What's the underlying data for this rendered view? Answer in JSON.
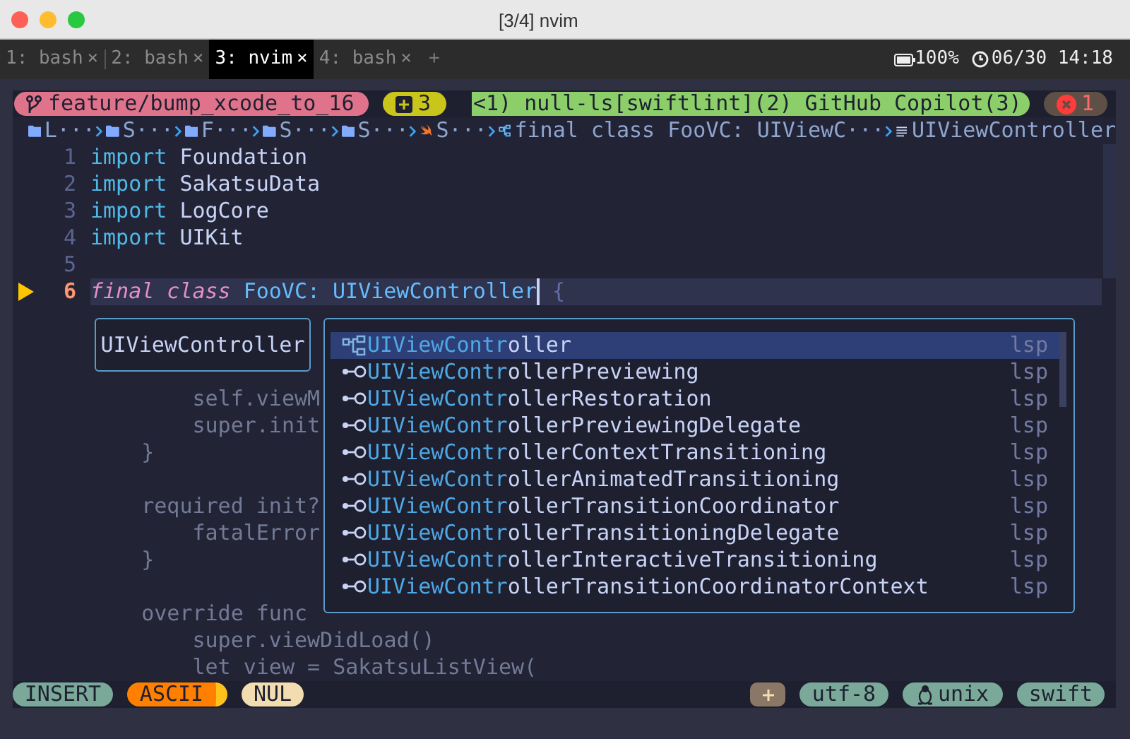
{
  "window": {
    "title": "[3/4] nvim"
  },
  "tabs": [
    {
      "label": "1: bash",
      "close": "×",
      "selected": false
    },
    {
      "label": "2: bash",
      "close": "×",
      "selected": false
    },
    {
      "label": "3: nvim",
      "close": "×",
      "selected": true
    },
    {
      "label": "4: bash",
      "close": "×",
      "selected": false
    }
  ],
  "new_tab": "+",
  "system_status": {
    "battery": "100%",
    "clock": "06/30 14:18"
  },
  "statusline": {
    "branch": "feature/bump_xcode_to_16",
    "added": "3",
    "lsp": "<1) null-ls[swiftlint](2) GitHub Copilot(3)",
    "errors": "1"
  },
  "breadcrumbs": [
    {
      "kind": "folder",
      "text": "L···"
    },
    {
      "kind": "folder",
      "text": "S···"
    },
    {
      "kind": "folder",
      "text": "F···"
    },
    {
      "kind": "folder",
      "text": "S···"
    },
    {
      "kind": "folder",
      "text": "S···"
    },
    {
      "kind": "swift",
      "text": "S···"
    },
    {
      "kind": "class",
      "text": "final class FooVC: UIViewC···"
    },
    {
      "kind": "field",
      "text": "UIViewController"
    }
  ],
  "lines": [
    {
      "number": "1",
      "current": false,
      "tokens": [
        {
          "kind": "keyword",
          "text": "import"
        },
        {
          "kind": "name",
          "text": "Foundation"
        }
      ]
    },
    {
      "number": "2",
      "current": false,
      "tokens": [
        {
          "kind": "keyword",
          "text": "import"
        },
        {
          "kind": "name",
          "text": "SakatsuData"
        }
      ]
    },
    {
      "number": "3",
      "current": false,
      "tokens": [
        {
          "kind": "keyword",
          "text": "import"
        },
        {
          "kind": "name",
          "text": "LogCore"
        }
      ]
    },
    {
      "number": "4",
      "current": false,
      "tokens": [
        {
          "kind": "keyword",
          "text": "import"
        },
        {
          "kind": "name",
          "text": "UIKit"
        }
      ]
    },
    {
      "number": "5",
      "current": false
    },
    {
      "number": "6",
      "current": true,
      "tokens": [
        {
          "kind": "storage",
          "text": "final class"
        },
        {
          "kind": "type",
          "text": "FooVC:"
        },
        {
          "kind": "type",
          "text": "UIViewController",
          "cursor_after": true
        },
        {
          "kind": "punct",
          "text": "{"
        }
      ]
    }
  ],
  "dimmed_lines": [
    {
      "kind": "code",
      "text": "        self.viewM"
    },
    {
      "kind": "code",
      "text": "        super.init"
    },
    {
      "kind": "code",
      "text": "    }"
    },
    {
      "kind": "blank"
    },
    {
      "kind": "code",
      "text": "    required init?"
    },
    {
      "kind": "code",
      "text": "        fatalError"
    },
    {
      "kind": "code",
      "text": "    }"
    },
    {
      "kind": "blank"
    },
    {
      "kind": "code",
      "text": "    override func"
    },
    {
      "kind": "code",
      "text": "        super.viewDidLoad()"
    },
    {
      "kind": "code",
      "text": "        let view = SakatsuListView("
    }
  ],
  "signature": {
    "text": "UIViewController"
  },
  "completions": [
    {
      "kind": "class",
      "match": "UIViewContr",
      "rest": "oller",
      "source": "lsp",
      "selected": true
    },
    {
      "kind": "protocol",
      "match": "UIViewContr",
      "rest": "ollerPreviewing",
      "source": "lsp",
      "selected": false
    },
    {
      "kind": "protocol",
      "match": "UIViewContr",
      "rest": "ollerRestoration",
      "source": "lsp",
      "selected": false
    },
    {
      "kind": "protocol",
      "match": "UIViewContr",
      "rest": "ollerPreviewingDelegate",
      "source": "lsp",
      "selected": false
    },
    {
      "kind": "protocol",
      "match": "UIViewContr",
      "rest": "ollerContextTransitioning",
      "source": "lsp",
      "selected": false
    },
    {
      "kind": "protocol",
      "match": "UIViewContr",
      "rest": "ollerAnimatedTransitioning",
      "source": "lsp",
      "selected": false
    },
    {
      "kind": "protocol",
      "match": "UIViewContr",
      "rest": "ollerTransitionCoordinator",
      "source": "lsp",
      "selected": false
    },
    {
      "kind": "protocol",
      "match": "UIViewContr",
      "rest": "ollerTransitioningDelegate",
      "source": "lsp",
      "selected": false
    },
    {
      "kind": "protocol",
      "match": "UIViewContr",
      "rest": "ollerInteractiveTransitioning",
      "source": "lsp",
      "selected": false
    },
    {
      "kind": "protocol",
      "match": "UIViewContr",
      "rest": "ollerTransitionCoordinatorContext",
      "source": "lsp",
      "selected": false
    }
  ],
  "bottom_status": {
    "mode": "INSERT",
    "input": "ASCII",
    "char": "NUL",
    "encoding": "utf-8",
    "format": "unix",
    "filetype": "swift"
  }
}
